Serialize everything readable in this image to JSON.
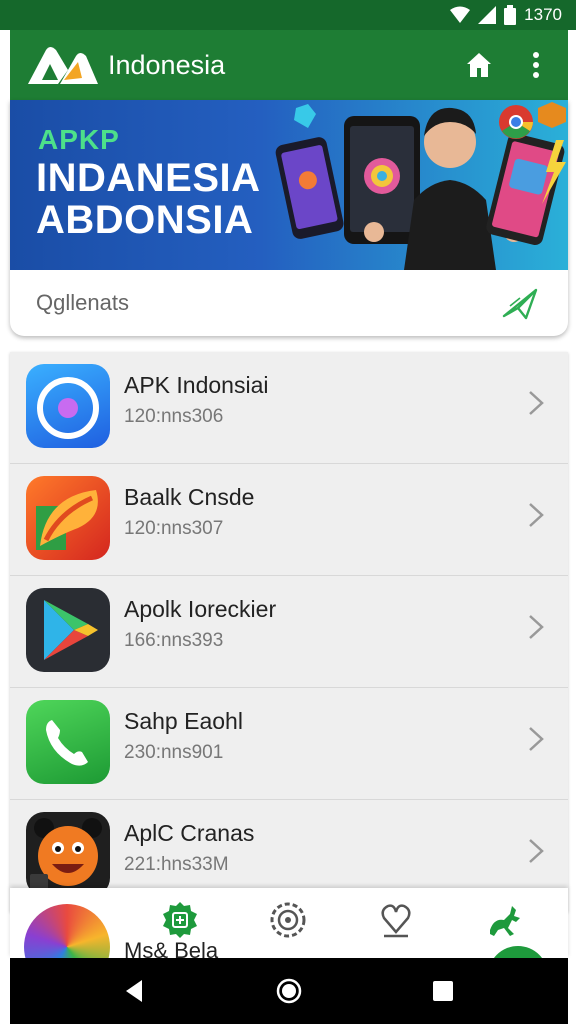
{
  "status_bar": {
    "time": "1370"
  },
  "app_bar": {
    "title": "Indonesia"
  },
  "banner": {
    "brand": "APKP",
    "line1": "INDANESIA",
    "line2": "ABDONSIA"
  },
  "search": {
    "text": "Qgllenats"
  },
  "apps": [
    {
      "name": "APK Indonsiai",
      "meta": "120:nns306",
      "icon": "camera-app-icon"
    },
    {
      "name": "Baalk Cnsde",
      "meta": "120:nns307",
      "icon": "brush-app-icon"
    },
    {
      "name": "Apolk Ioreckier",
      "meta": "166:nns393",
      "icon": "play-store-icon"
    },
    {
      "name": "Sahp Eaohl",
      "meta": "230:nns901",
      "icon": "phone-app-icon"
    },
    {
      "name": "AplC Cranas",
      "meta": "221:hns33M",
      "icon": "emoji-app-icon"
    }
  ],
  "bottom_nav": {
    "label": "Ms& Bela"
  },
  "colors": {
    "primary": "#1e7d34",
    "status": "#15682b",
    "accent": "#1e9a3c"
  }
}
